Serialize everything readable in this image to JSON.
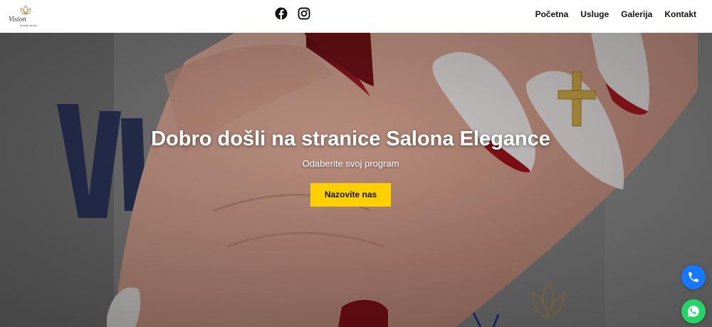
{
  "header": {
    "logo": {
      "text": "Vision",
      "subtext": "beauty studio"
    },
    "social": [
      {
        "icon": "facebook-icon"
      },
      {
        "icon": "instagram-icon"
      }
    ],
    "nav": [
      {
        "label": "Početna"
      },
      {
        "label": "Usluge"
      },
      {
        "label": "Galerija"
      },
      {
        "label": "Kontakt"
      }
    ]
  },
  "hero": {
    "title": "Dobro došli na stranice Salona Elegance",
    "subtitle": "Odaberite svoj program",
    "cta_label": "Nazovite nas"
  },
  "floating": {
    "phone_icon": "phone-icon",
    "whatsapp_icon": "whatsapp-icon"
  },
  "colors": {
    "cta": "#ffd000",
    "phone_fab": "#1677ff",
    "whatsapp_fab": "#25d366",
    "logo_gold": "#b8975a"
  }
}
